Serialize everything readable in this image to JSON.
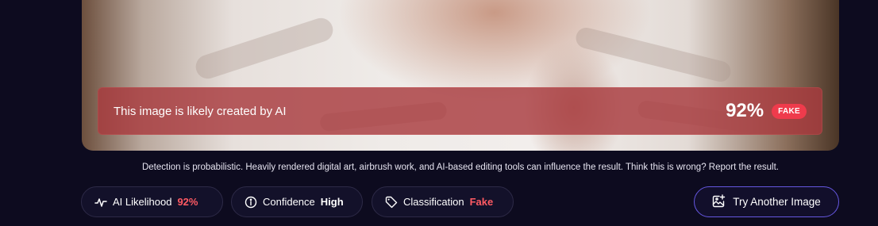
{
  "banner": {
    "message": "This image is likely created by AI",
    "score": "92%",
    "badge": "FAKE"
  },
  "disclaimer": "Detection is probabilistic. Heavily rendered digital art, airbrush work, and AI-based editing tools can influence the result. Think this is wrong? Report the result.",
  "stats": {
    "likelihood": {
      "label": "AI Likelihood",
      "value": "92%",
      "icon": "activity-pulse-icon"
    },
    "confidence": {
      "label": "Confidence",
      "value": "High",
      "icon": "info-circle-icon"
    },
    "classification": {
      "label": "Classification",
      "value": "Fake",
      "icon": "tag-icon"
    }
  },
  "actions": {
    "try_another": "Try Another Image",
    "try_icon": "image-plus-icon"
  },
  "colors": {
    "background": "#0d0b1f",
    "banner": "#a83a3e",
    "accent_red": "#ff5a63",
    "button_border": "#6557e0"
  }
}
